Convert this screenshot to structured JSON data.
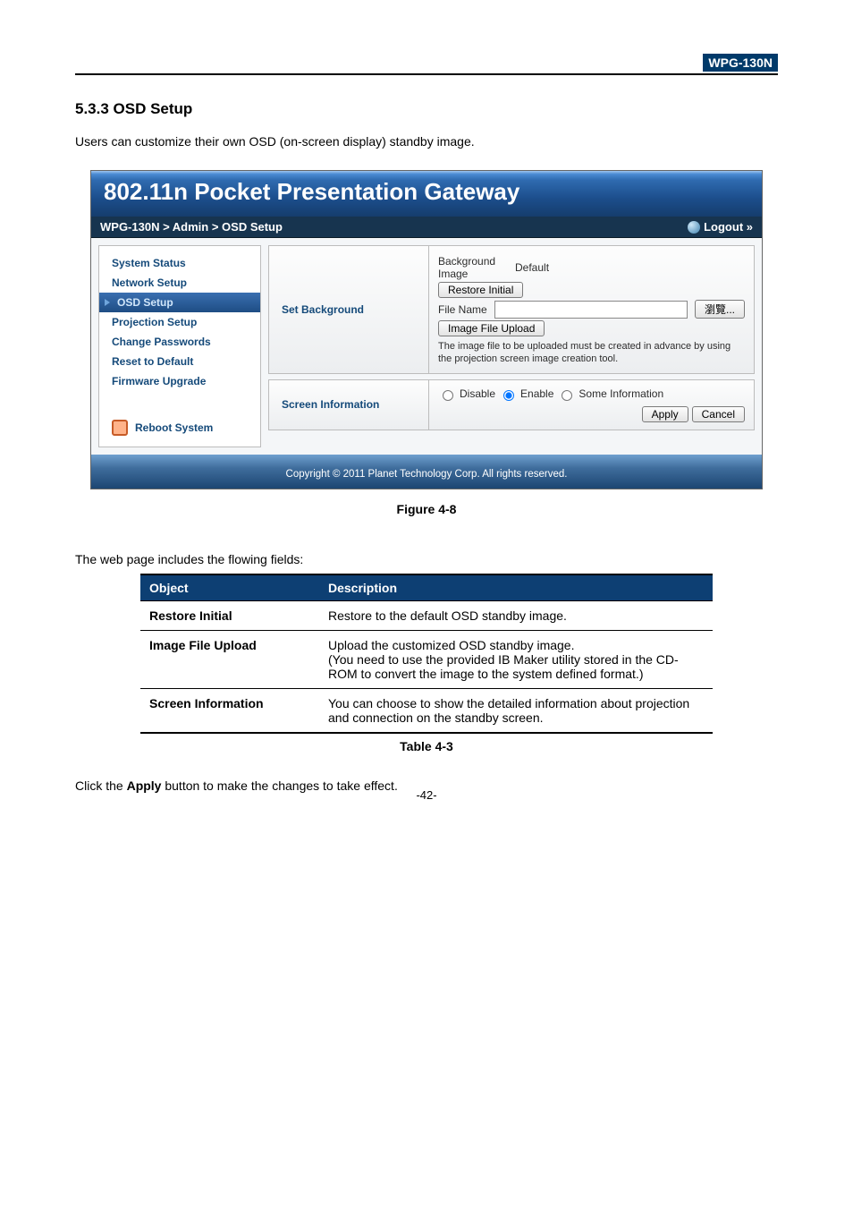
{
  "badge": "WPG-130N",
  "heading": "5.3.3  OSD Setup",
  "intro": "Users can customize their own OSD (on-screen display) standby image.",
  "ui": {
    "title": "802.11n Pocket Presentation Gateway",
    "breadcrumb": "WPG-130N > Admin > OSD Setup",
    "logout": "Logout »",
    "nav": {
      "system_status": "System Status",
      "network_setup": "Network Setup",
      "osd_setup": "OSD Setup",
      "projection_setup": "Projection Setup",
      "change_passwords": "Change Passwords",
      "reset_to_default": "Reset to Default",
      "firmware_upgrade": "Firmware Upgrade",
      "reboot_system": "Reboot System"
    },
    "set_bg": {
      "label": "Set Background",
      "bg_image_label": "Background Image",
      "bg_image_value": "Default",
      "restore_btn": "Restore Initial",
      "file_name_label": "File Name",
      "browse_btn": "瀏覽...",
      "upload_btn": "Image File Upload",
      "hint": "The image file to be uploaded must be created in advance by using the projection screen image creation tool."
    },
    "screen_info": {
      "label": "Screen Information",
      "disable": "Disable",
      "enable": "Enable",
      "some": "Some Information",
      "apply": "Apply",
      "cancel": "Cancel"
    },
    "copyright": "Copyright © 2011 Planet Technology Corp. All rights reserved."
  },
  "figure_caption": "Figure 4-8",
  "fields_intro": "The web page includes the flowing fields:",
  "table_header_object": "Object",
  "table_header_desc": "Description",
  "table_rows": {
    "r1o": "Restore Initial",
    "r1d": "Restore to the default OSD standby image.",
    "r2o": "Image File Upload",
    "r2d": "Upload the customized OSD standby image.\n(You need to use the provided IB Maker utility stored in the CD-ROM to convert the image to the system defined format.)",
    "r3o": "Screen Information",
    "r3d": "You can choose to show the detailed information about projection and connection on the standby screen."
  },
  "table_caption": "Table 4-3",
  "closing_before": "Click the ",
  "closing_bold": "Apply",
  "closing_after": " button to make the changes to take effect.",
  "pagenum": "-42-"
}
